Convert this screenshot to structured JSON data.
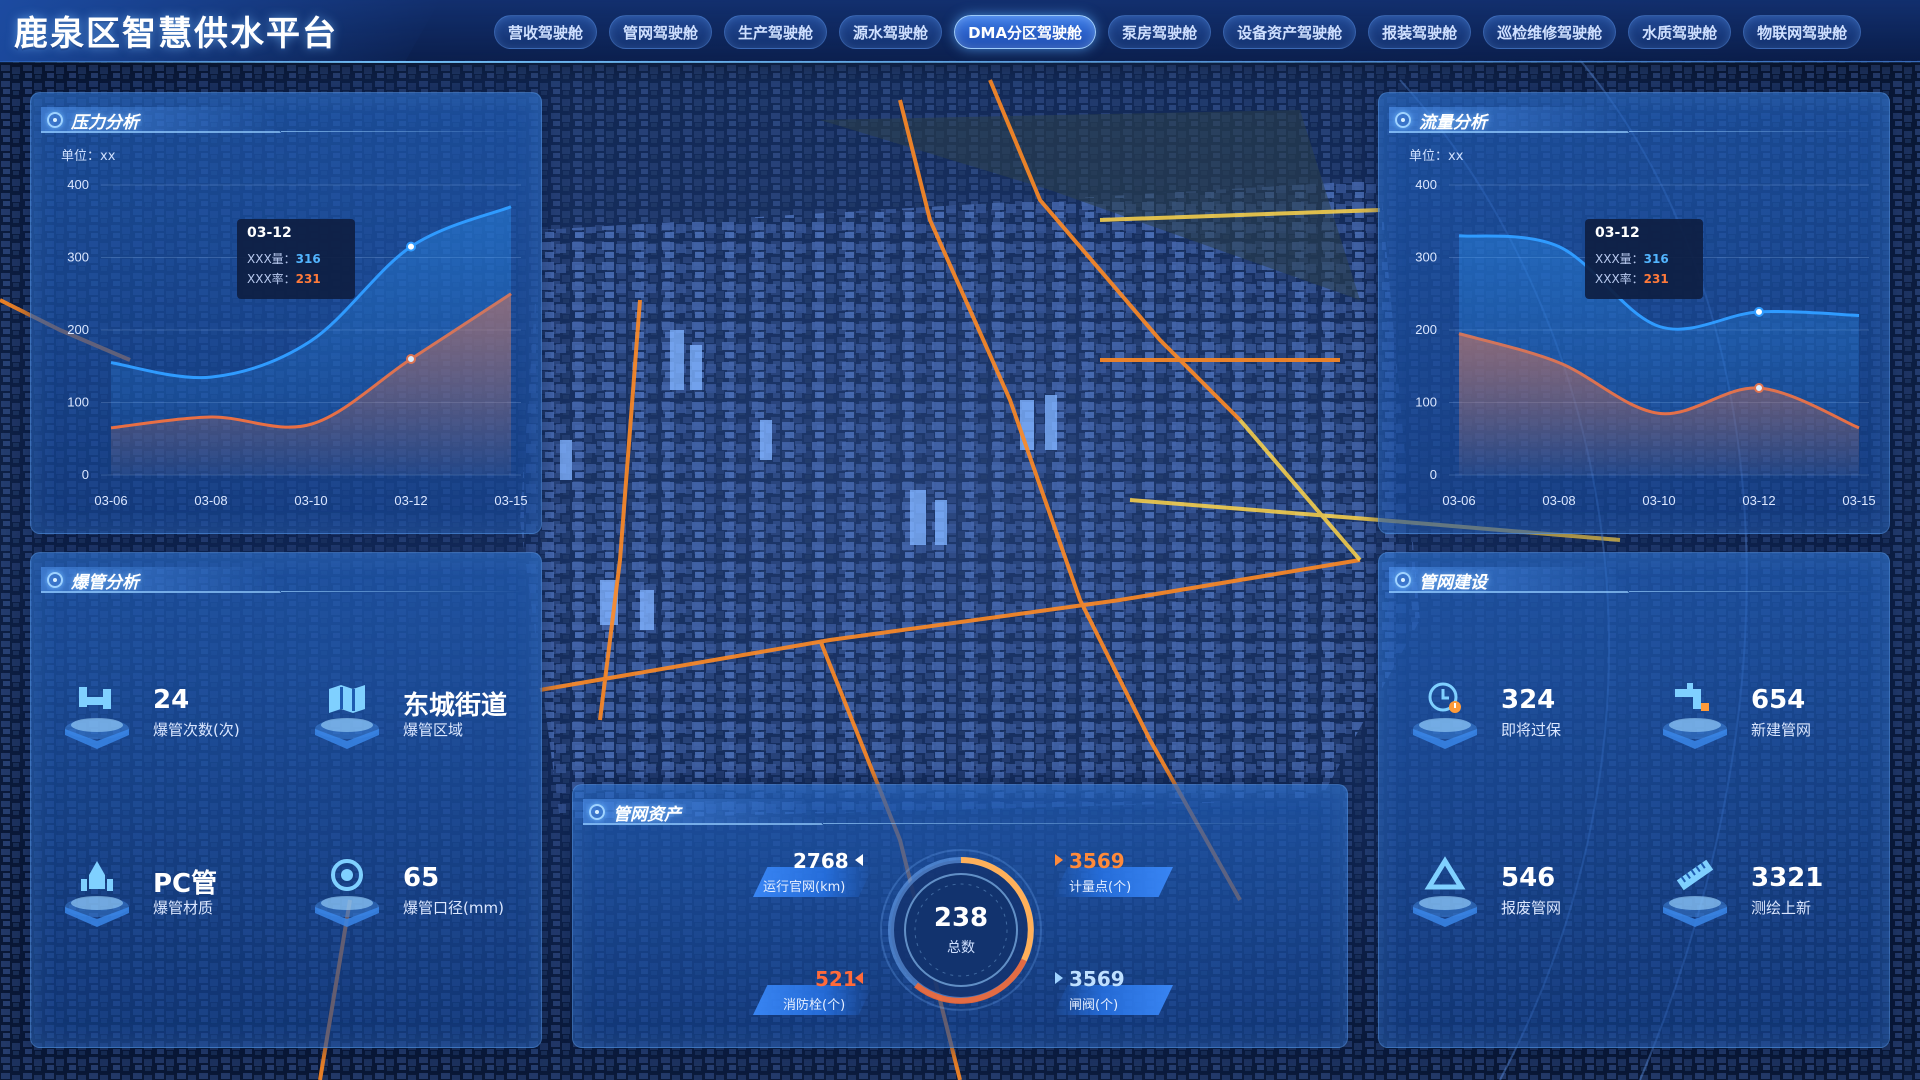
{
  "app": {
    "title": "鹿泉区智慧供水平台"
  },
  "nav": {
    "tabs": [
      {
        "label": "营收驾驶舱"
      },
      {
        "label": "管网驾驶舱"
      },
      {
        "label": "生产驾驶舱"
      },
      {
        "label": "源水驾驶舱"
      },
      {
        "label": "DMA分区驾驶舱",
        "active": true
      },
      {
        "label": "泵房驾驶舱"
      },
      {
        "label": "设备资产驾驶舱"
      },
      {
        "label": "报装驾驶舱"
      },
      {
        "label": "巡检维修驾驶舱"
      },
      {
        "label": "水质驾驶舱"
      },
      {
        "label": "物联网驾驶舱"
      }
    ]
  },
  "pressure": {
    "title": "压力分析",
    "unit": "单位：xx",
    "tooltip": {
      "date": "03-12",
      "a_label": "XXX量：",
      "a_value": "316",
      "b_label": "XXX率：",
      "b_value": "231"
    }
  },
  "flow": {
    "title": "流量分析",
    "unit": "单位：xx",
    "tooltip": {
      "date": "03-12",
      "a_label": "XXX量：",
      "a_value": "316",
      "b_label": "XXX率：",
      "b_value": "231"
    }
  },
  "burst": {
    "title": "爆管分析",
    "items": [
      {
        "value": "24",
        "label": "爆管次数(次)",
        "icon": "pipe-joint-icon"
      },
      {
        "value": "东城街道",
        "label": "爆管区域",
        "icon": "map-icon"
      },
      {
        "value": "PC管",
        "label": "爆管材质",
        "icon": "material-icon"
      },
      {
        "value": "65",
        "label": "爆管口径(mm)",
        "icon": "target-icon"
      }
    ]
  },
  "construction": {
    "title": "管网建设",
    "items": [
      {
        "value": "324",
        "label": "即将过保",
        "icon": "clock-warning-icon"
      },
      {
        "value": "654",
        "label": "新建管网",
        "icon": "faucet-icon"
      },
      {
        "value": "546",
        "label": "报废管网",
        "icon": "recycle-icon"
      },
      {
        "value": "3321",
        "label": "测绘上新",
        "icon": "ruler-icon"
      }
    ]
  },
  "assets": {
    "title": "管网资产",
    "total_value": "238",
    "total_label": "总数",
    "items": [
      {
        "value": "2768",
        "label": "运行官网(km)"
      },
      {
        "value": "3569",
        "label": "计量点(个)"
      },
      {
        "value": "521",
        "label": "消防栓(个)"
      },
      {
        "value": "3569",
        "label": "闸阀(个)"
      }
    ]
  },
  "colors": {
    "series_a": "#2f9bff",
    "series_b": "#ff6a2e",
    "accent": "#5ab8ff",
    "asset_orange": "#ff8a3a"
  },
  "chart_data": [
    {
      "type": "area",
      "title": "压力分析",
      "ylabel": "单位：xx",
      "x": [
        "03-06",
        "03-08",
        "03-10",
        "03-12",
        "03-15"
      ],
      "yticks": [
        0,
        100,
        200,
        300,
        400
      ],
      "ylim": [
        0,
        400
      ],
      "series": [
        {
          "values": [
            155,
            135,
            185,
            315,
            370
          ]
        },
        {
          "values": [
            65,
            80,
            70,
            160,
            250
          ]
        }
      ]
    },
    {
      "type": "area",
      "title": "流量分析",
      "ylabel": "单位：xx",
      "x": [
        "03-06",
        "03-08",
        "03-10",
        "03-12",
        "03-15"
      ],
      "yticks": [
        0,
        100,
        200,
        300,
        400
      ],
      "ylim": [
        0,
        400
      ],
      "series": [
        {
          "values": [
            330,
            315,
            205,
            225,
            220
          ]
        },
        {
          "values": [
            195,
            155,
            85,
            120,
            65
          ]
        }
      ]
    }
  ]
}
